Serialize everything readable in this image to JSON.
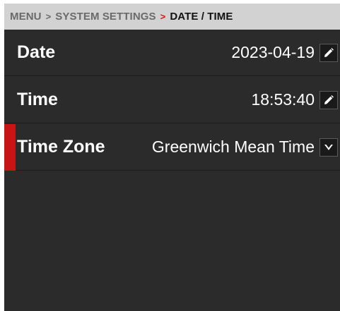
{
  "breadcrumb": {
    "items": [
      "MENU",
      "SYSTEM SETTINGS"
    ],
    "current": "DATE / TIME",
    "separator": ">"
  },
  "settings": [
    {
      "label": "Date",
      "value": "2023-04-19",
      "control": "edit-icon"
    },
    {
      "label": "Time",
      "value": "18:53:40",
      "control": "edit-icon"
    },
    {
      "label": "Time Zone",
      "value": "Greenwich Mean Time",
      "control": "chevron-down-icon",
      "selected": true
    }
  ],
  "colors": {
    "accent": "#c81414",
    "panel": "#2b2b2b",
    "header": "#d2d2d2"
  }
}
